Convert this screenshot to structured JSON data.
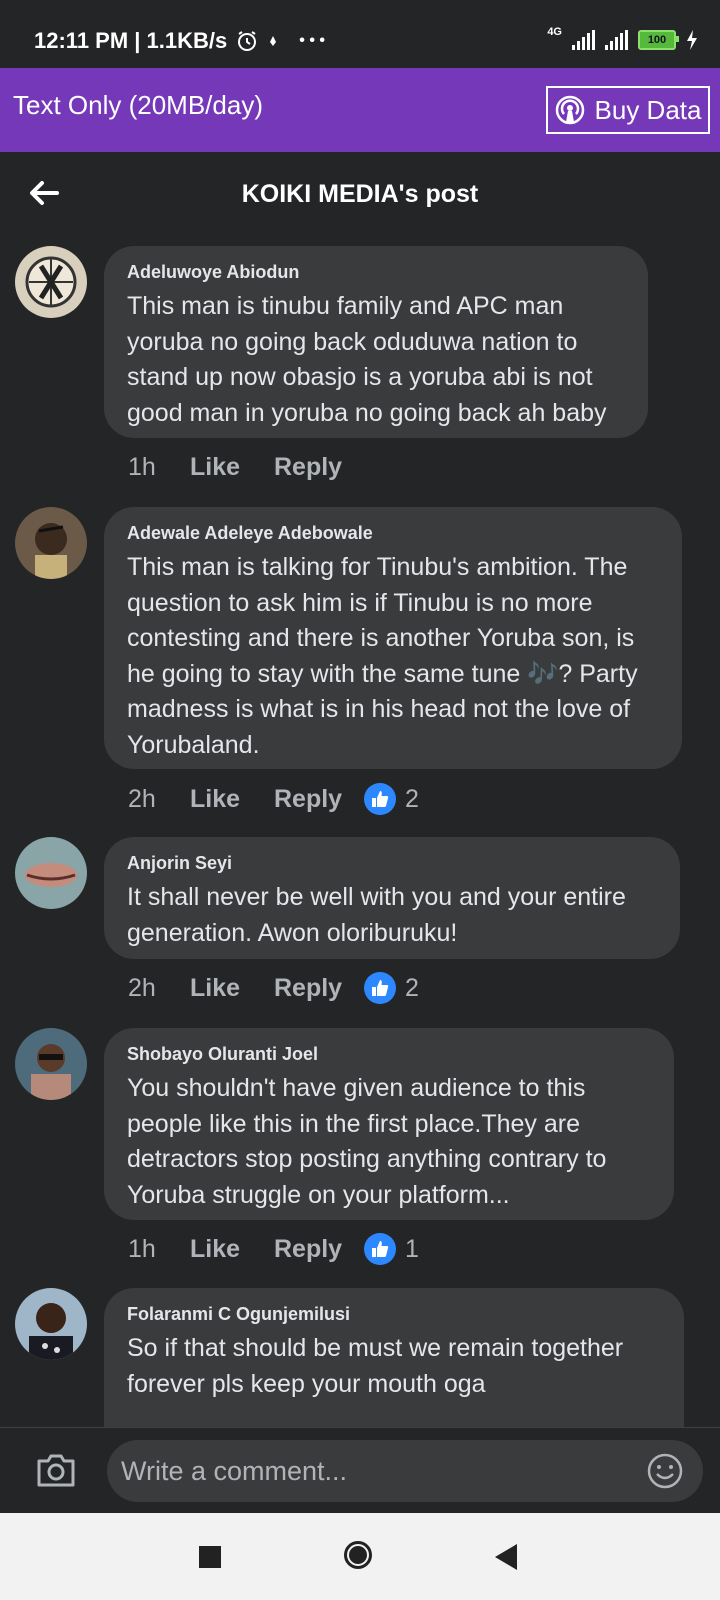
{
  "status_bar": {
    "time_speed": "12:11 PM | 1.1KB/s",
    "more": "• • •",
    "network": "4G",
    "battery": "100"
  },
  "data_banner": {
    "plan_label": "Text Only (20MB/day)",
    "buy_label": "Buy Data"
  },
  "header": {
    "title": "KOIKI MEDIA's post"
  },
  "comments": [
    {
      "name": "Adeluwoye Abiodun",
      "text": "This man is tinubu family and APC man yoruba no going back oduduwa nation to stand up now obasjo is a yoruba abi is not good man in yoruba no going back ah baby",
      "time": "1h",
      "like": "Like",
      "reply": "Reply",
      "reactions": ""
    },
    {
      "name": "Adewale Adeleye Adebowale",
      "text": "This man is talking for Tinubu's ambition. The question to ask him is if Tinubu is no more contesting and there is another Yoruba son, is he going to stay with the same tune 🎶? Party madness is what is in his head not the love of Yorubaland.",
      "time": "2h",
      "like": "Like",
      "reply": "Reply",
      "reactions": "2"
    },
    {
      "name": "Anjorin Seyi",
      "text": "It shall never be well with you and your entire generation. Awon oloriburuku!",
      "time": "2h",
      "like": "Like",
      "reply": "Reply",
      "reactions": "2"
    },
    {
      "name": "Shobayo Oluranti Joel",
      "text": "You shouldn't have given audience to this people like this in the first place.They are detractors stop posting anything contrary to Yoruba struggle on your platform...",
      "time": "1h",
      "like": "Like",
      "reply": "Reply",
      "reactions": "1"
    },
    {
      "name": "Folaranmi C Ogunjemilusi",
      "text": "So if that should be must we remain together forever pls keep your mouth oga"
    }
  ],
  "composer": {
    "placeholder": "Write a comment..."
  },
  "colors": {
    "banner": "#7438b8",
    "background": "#242526",
    "bubble": "#3a3b3c",
    "like_badge": "#2d88ff"
  }
}
